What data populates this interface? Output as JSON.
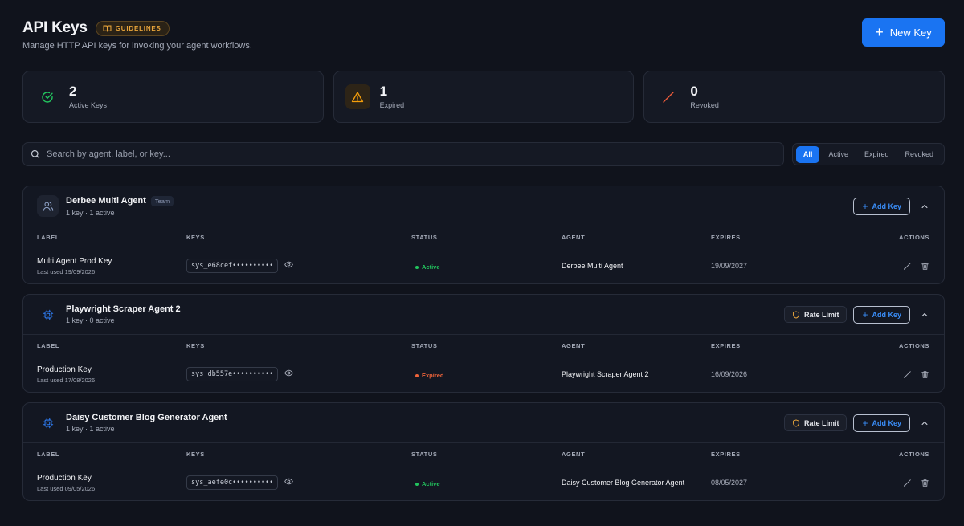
{
  "header": {
    "title": "API Keys",
    "guidelines_label": "GUIDELINES",
    "subtitle": "Manage HTTP API keys for invoking your agent workflows.",
    "new_key_label": "New Key"
  },
  "stats": [
    {
      "value": "2",
      "label": "Active Keys",
      "icon": "check-circle-icon",
      "color": "#22c55e"
    },
    {
      "value": "1",
      "label": "Expired",
      "icon": "warning-icon",
      "color": "#f59e0b"
    },
    {
      "value": "0",
      "label": "Revoked",
      "icon": "slash-icon",
      "color": "#ef5b3a"
    }
  ],
  "search": {
    "placeholder": "Search by agent, label, or key..."
  },
  "filters": {
    "all": "All",
    "active": "Active",
    "expired": "Expired",
    "revoked": "Revoked",
    "selected": "All"
  },
  "columns": {
    "label": "LABEL",
    "keys": "KEYS",
    "status": "STATUS",
    "agent": "AGENT",
    "expires": "EXPIRES",
    "actions": "ACTIONS"
  },
  "groups": [
    {
      "name": "Derbee Multi Agent",
      "badge": "Team",
      "meta": "1 key · 1 active",
      "icon": "users-icon",
      "rate_limit": "",
      "add_key": "Add Key",
      "rows": [
        {
          "label": "Multi Agent Prod Key",
          "last_used": "Last used 19/09/2026",
          "key": "sys_e68cef••••••••••",
          "status": "Active",
          "status_color": "#22c55e",
          "agent": "Derbee Multi Agent",
          "expires": "19/09/2027"
        }
      ]
    },
    {
      "name": "Playwright Scraper Agent 2",
      "badge": "",
      "meta": "1 key · 0 active",
      "icon": "cpu-icon",
      "rate_limit": "Rate Limit",
      "add_key": "Add Key",
      "rows": [
        {
          "label": "Production Key",
          "last_used": "Last used 17/08/2026",
          "key": "sys_db557e••••••••••",
          "status": "Expired",
          "status_color": "#f0643a",
          "agent": "Playwright Scraper Agent 2",
          "expires": "16/09/2026"
        }
      ]
    },
    {
      "name": "Daisy Customer Blog Generator Agent",
      "badge": "",
      "meta": "1 key · 1 active",
      "icon": "cpu-icon",
      "rate_limit": "Rate Limit",
      "add_key": "Add Key",
      "rows": [
        {
          "label": "Production Key",
          "last_used": "Last used 09/05/2026",
          "key": "sys_aefe0c••••••••••",
          "status": "Active",
          "status_color": "#22c55e",
          "agent": "Daisy Customer Blog Generator Agent",
          "expires": "08/05/2027"
        }
      ]
    }
  ],
  "colors": {
    "accent": "#1a74f2",
    "warning": "#e9a53b",
    "success": "#22c55e",
    "danger": "#f0643a"
  }
}
